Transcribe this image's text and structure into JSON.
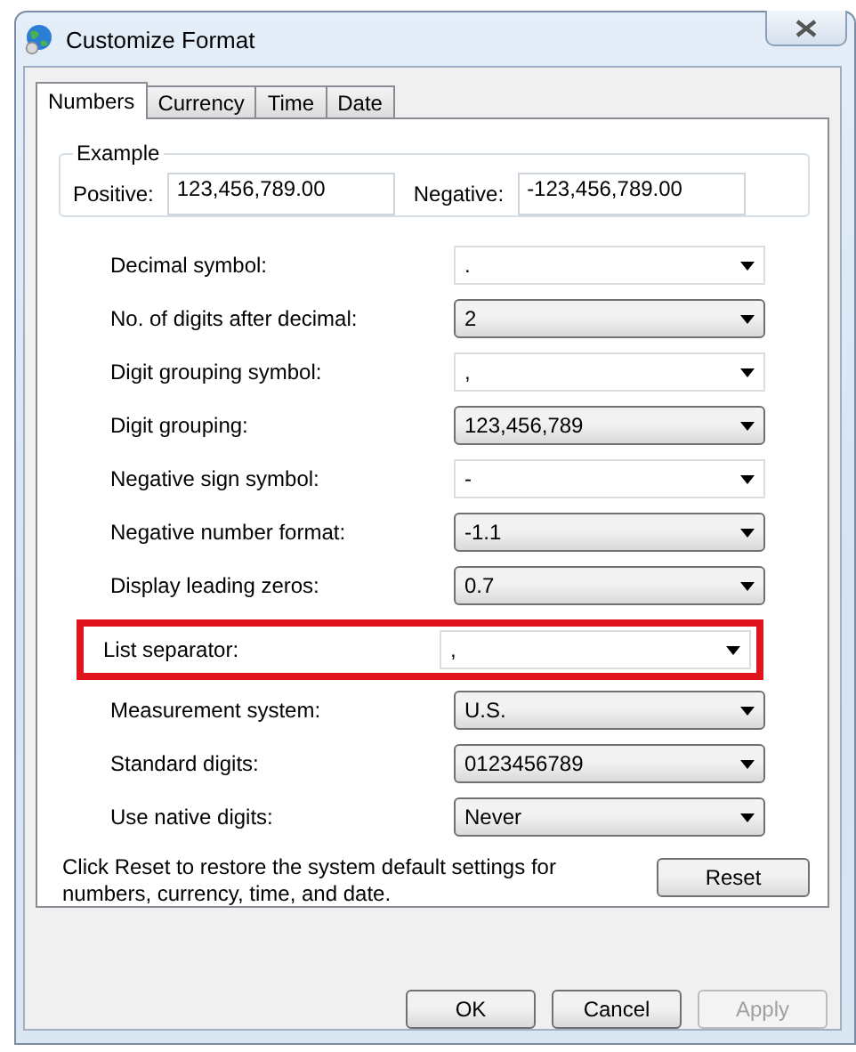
{
  "window": {
    "title": "Customize Format"
  },
  "tabs": [
    {
      "label": "Numbers",
      "selected": true
    },
    {
      "label": "Currency",
      "selected": false
    },
    {
      "label": "Time",
      "selected": false
    },
    {
      "label": "Date",
      "selected": false
    }
  ],
  "example": {
    "title": "Example",
    "fields": [
      {
        "label": "Positive:",
        "value": "123,456,789.00"
      },
      {
        "label": "Negative:",
        "value": "-123,456,789.00"
      }
    ]
  },
  "settings": [
    {
      "label": "Decimal symbol:",
      "value": ".",
      "kind": "editable",
      "highlighted": false
    },
    {
      "label": "No. of digits after decimal:",
      "value": "2",
      "kind": "list",
      "highlighted": false
    },
    {
      "label": "Digit grouping symbol:",
      "value": ",",
      "kind": "editable",
      "highlighted": false
    },
    {
      "label": "Digit grouping:",
      "value": "123,456,789",
      "kind": "list",
      "highlighted": false
    },
    {
      "label": "Negative sign symbol:",
      "value": "-",
      "kind": "editable",
      "highlighted": false
    },
    {
      "label": "Negative number format:",
      "value": "-1.1",
      "kind": "list",
      "highlighted": false
    },
    {
      "label": "Display leading zeros:",
      "value": "0.7",
      "kind": "list",
      "highlighted": false
    },
    {
      "label": "List separator:",
      "value": ",",
      "kind": "editable",
      "highlighted": true
    },
    {
      "label": "Measurement system:",
      "value": "U.S.",
      "kind": "list",
      "highlighted": false
    },
    {
      "label": "Standard digits:",
      "value": "0123456789",
      "kind": "list",
      "highlighted": false
    },
    {
      "label": "Use native digits:",
      "value": "Never",
      "kind": "list",
      "highlighted": false
    }
  ],
  "reset": {
    "note": "Click Reset to restore the system default settings for numbers, currency, time, and date.",
    "button": "Reset"
  },
  "buttons": [
    {
      "label": "OK",
      "disabled": false
    },
    {
      "label": "Cancel",
      "disabled": false
    },
    {
      "label": "Apply",
      "disabled": true
    }
  ]
}
